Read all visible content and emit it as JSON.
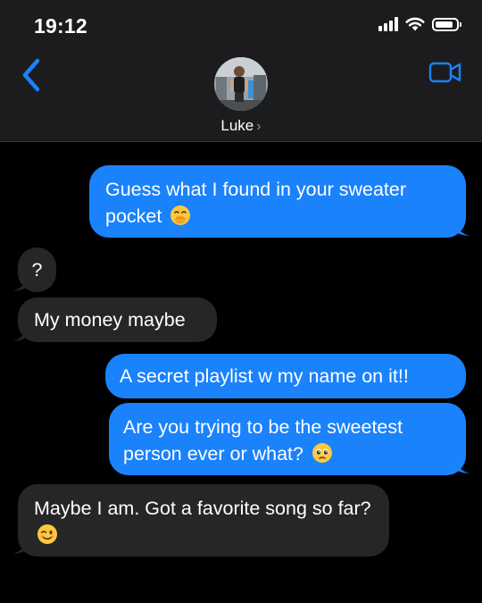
{
  "status_bar": {
    "time": "19:12",
    "signal_bars": 4,
    "battery_level": 0.85
  },
  "header": {
    "contact_name": "Luke",
    "chevron": "›",
    "back_icon": "chevron-left-icon",
    "video_icon": "video-camera-icon"
  },
  "colors": {
    "accent": "#1a82fb",
    "incoming_bubble": "#262629",
    "header_bg": "#1c1c1e"
  },
  "messages": [
    {
      "direction": "outgoing",
      "text": "Guess what I found in your sweater pocket",
      "emoji": "face-with-hand-over-mouth"
    },
    {
      "direction": "incoming",
      "text": "?"
    },
    {
      "direction": "incoming",
      "text": "My money maybe"
    },
    {
      "direction": "outgoing",
      "text": "A secret playlist w my name on it!!"
    },
    {
      "direction": "outgoing",
      "text": "Are you trying to be the sweetest person ever or what?",
      "emoji": "pleading-face"
    },
    {
      "direction": "incoming",
      "text": "Maybe I am. Got a favorite song so far?",
      "emoji": "winking-face"
    }
  ]
}
